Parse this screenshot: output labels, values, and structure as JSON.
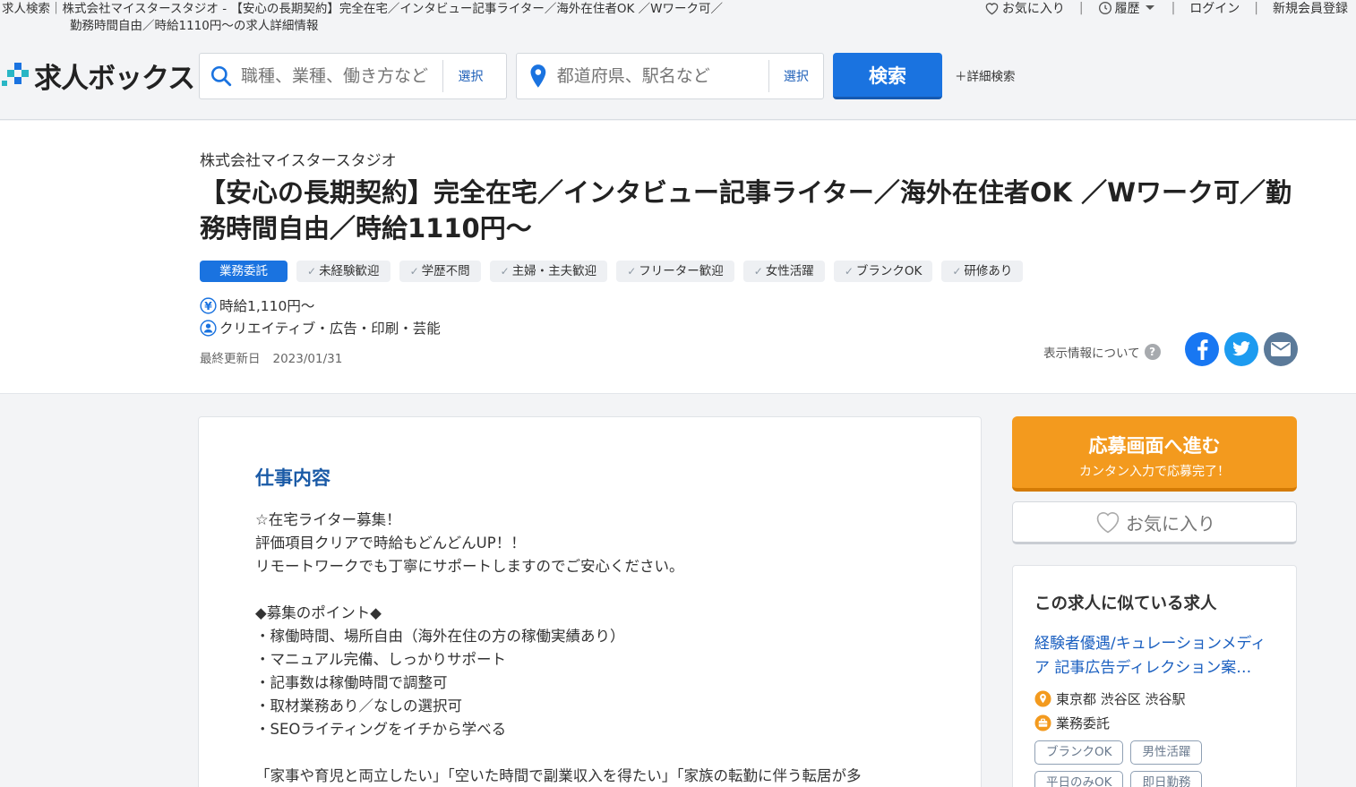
{
  "header": {
    "breadcrumb_line1": "求人検索｜株式会社マイスタースタジオ - 【安心の長期契約】完全在宅／インタビュー記事ライター／海外在住者OK ／Wワーク可／",
    "breadcrumb_line2": "勤務時間自由／時給1110円〜の求人詳細情報",
    "nav": {
      "favorites": "お気に入り",
      "history": "履歴",
      "login": "ログイン",
      "register": "新規会員登録"
    },
    "logo_text": "求人ボックス",
    "search": {
      "keyword_placeholder": "職種、業種、働き方など",
      "keyword_select": "選択",
      "location_placeholder": "都道府県、駅名など",
      "location_select": "選択",
      "button": "検索",
      "advanced": "＋詳細検索"
    }
  },
  "job": {
    "company": "株式会社マイスタースタジオ",
    "title": "【安心の長期契約】完全在宅／インタビュー記事ライター／海外在住者OK ／Wワーク可／勤務時間自由／時給1110円〜",
    "employment_type": "業務委託",
    "tags": [
      "未経験歓迎",
      "学歴不問",
      "主婦・主夫歓迎",
      "フリーター歓迎",
      "女性活躍",
      "ブランクOK",
      "研修あり"
    ],
    "salary": "時給1,110円〜",
    "category": "クリエイティブ・広告・印刷・芸能",
    "updated_label": "最終更新日",
    "updated_date": "2023/01/31",
    "display_info": "表示情報について"
  },
  "content": {
    "section_title": "仕事内容",
    "description": "☆在宅ライター募集！\n評価項目クリアで時給もどんどんUP！！\nリモートワークでも丁寧にサポートしますのでご安心ください。\n\n◆募集のポイント◆\n・稼働時間、場所自由（海外在住の方の稼働実績あり）\n・マニュアル完備、しっかりサポート\n・記事数は稼働時間で調整可\n・取材業務あり／なしの選択可\n・SEOライティングをイチから学べる\n\n「家事や育児と両立したい」「空いた時間で副業収入を得たい」「家族の転勤に伴う転居が多"
  },
  "sidebar": {
    "apply_title": "応募画面へ進む",
    "apply_sub": "カンタン入力で応募完了！",
    "favorite": "お気に入り",
    "similar_title": "この求人に似ている求人",
    "similar_job": {
      "title": "経験者優遇/キュレーションメディア 記事広告ディレクション案…",
      "location": "東京都 渋谷区 渋谷駅",
      "type": "業務委託",
      "tags": [
        "ブランクOK",
        "男性活躍",
        "平日のみOK",
        "即日勤務"
      ]
    }
  },
  "colors": {
    "primary": "#1a73e0",
    "apply": "#f39a1e",
    "link": "#1a5fc0",
    "facebook": "#1877f2",
    "twitter": "#1d9bf0",
    "mail": "#5b7a99"
  }
}
